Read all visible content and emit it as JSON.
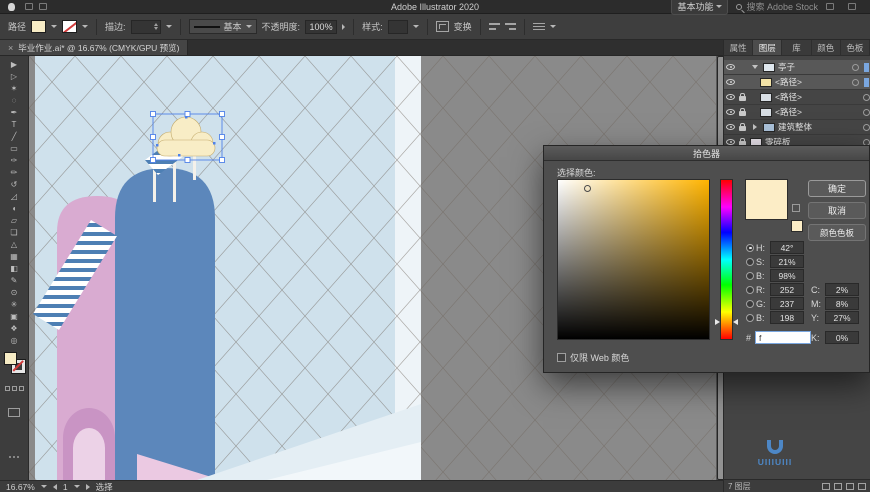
{
  "app_bar": {
    "title": "Adobe Illustrator 2020",
    "workspace_button": "基本功能",
    "search_placeholder": "搜索 Adobe Stock"
  },
  "control_bar": {
    "context_label": "路径",
    "stroke_label": "描边:",
    "brush_preset": "基本",
    "opacity_label": "不透明度:",
    "opacity_value": "100%",
    "style_label": "样式:",
    "transform_label": "变换"
  },
  "document_tab": {
    "close": "×",
    "title": "毕业作业.ai* @ 16.67% (CMYK/GPU 预览)"
  },
  "tools": [
    {
      "name": "selection",
      "glyph": "▶"
    },
    {
      "name": "direct-selection",
      "glyph": "▷"
    },
    {
      "name": "magic-wand",
      "glyph": "✶"
    },
    {
      "name": "lasso",
      "glyph": "◌"
    },
    {
      "name": "pen",
      "glyph": "✒"
    },
    {
      "name": "type",
      "glyph": "T"
    },
    {
      "name": "line-segment",
      "glyph": "╱"
    },
    {
      "name": "rectangle",
      "glyph": "▭"
    },
    {
      "name": "paintbrush",
      "glyph": "✑"
    },
    {
      "name": "pencil",
      "glyph": "✏"
    },
    {
      "name": "rotate",
      "glyph": "↺"
    },
    {
      "name": "scale",
      "glyph": "◿"
    },
    {
      "name": "width",
      "glyph": "◖"
    },
    {
      "name": "free-transform",
      "glyph": "▱"
    },
    {
      "name": "shape-builder",
      "glyph": "❏"
    },
    {
      "name": "perspective-grid",
      "glyph": "△"
    },
    {
      "name": "mesh",
      "glyph": "▦"
    },
    {
      "name": "gradient",
      "glyph": "◧"
    },
    {
      "name": "eyedropper",
      "glyph": "✎"
    },
    {
      "name": "blend",
      "glyph": "⊙"
    },
    {
      "name": "symbol-sprayer",
      "glyph": "✳"
    },
    {
      "name": "artboard",
      "glyph": "▣"
    },
    {
      "name": "hand",
      "glyph": "❖"
    },
    {
      "name": "zoom",
      "glyph": "◎"
    }
  ],
  "right_panel": {
    "tabs": [
      "属性",
      "图层",
      "库",
      "颜色",
      "色板"
    ],
    "layers": [
      {
        "label": "亭子"
      },
      {
        "label": "<路径>"
      },
      {
        "label": "<路径>"
      },
      {
        "label": "<路径>"
      },
      {
        "label": "建筑整体"
      },
      {
        "label": "零碎板"
      }
    ],
    "footer_status": "7 图层"
  },
  "color_picker": {
    "title": "拾色器",
    "select_label": "选择颜色:",
    "ok_button": "确定",
    "cancel_button": "取消",
    "swatches_button": "颜色色板",
    "picked_color_hex": "#FCEDC6",
    "hsb": [
      {
        "label": "H:",
        "value": "42°"
      },
      {
        "label": "S:",
        "value": "21%"
      },
      {
        "label": "B:",
        "value": "98%"
      }
    ],
    "rgb": [
      {
        "label": "R:",
        "value": "252"
      },
      {
        "label": "G:",
        "value": "237"
      },
      {
        "label": "B:",
        "value": "198"
      }
    ],
    "cmyk": [
      {
        "label": "C:",
        "value": "2%"
      },
      {
        "label": "M:",
        "value": "8%"
      },
      {
        "label": "Y:",
        "value": "27%"
      },
      {
        "label": "K:",
        "value": "0%"
      }
    ],
    "hex_label": "#",
    "hex_value": "f",
    "web_only_label": "仅限 Web 颜色"
  },
  "status_bar": {
    "zoom": "16.67%",
    "artboard_number": "1",
    "tool_status": "选择"
  },
  "watermark": {
    "text": "UIIIUIII"
  }
}
